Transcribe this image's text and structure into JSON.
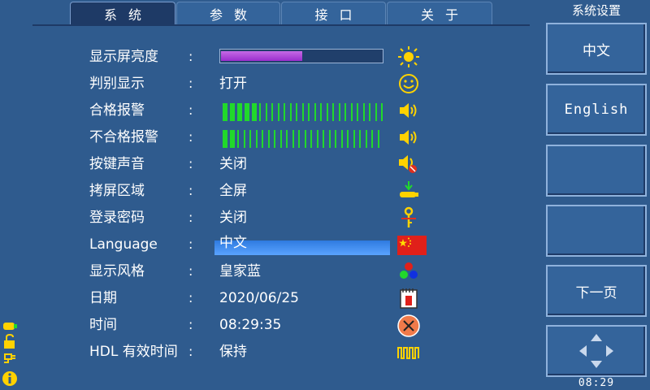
{
  "tabs": [
    {
      "label": "系统",
      "active": true
    },
    {
      "label": "参数",
      "active": false
    },
    {
      "label": "接口",
      "active": false
    },
    {
      "label": "关于",
      "active": false
    }
  ],
  "settings": {
    "brightness": {
      "label": "显示屏亮度",
      "level": 0.5
    },
    "judge_display": {
      "label": "判别显示",
      "value": "打开"
    },
    "pass_alarm": {
      "label": "合格报警",
      "level_ticks": 5,
      "total_ticks": 26
    },
    "fail_alarm": {
      "label": "不合格报警",
      "level_ticks": 2,
      "total_ticks": 26
    },
    "key_sound": {
      "label": "按键声音",
      "value": "关闭"
    },
    "capture_area": {
      "label": "拷屏区域",
      "value": "全屏"
    },
    "login_password": {
      "label": "登录密码",
      "value": "关闭"
    },
    "language": {
      "label": "Language",
      "value": "中文"
    },
    "display_style": {
      "label": "显示风格",
      "value": "皇家蓝"
    },
    "date": {
      "label": "日期",
      "value": "2020/06/25"
    },
    "time": {
      "label": "时间",
      "value": "08:29:35"
    },
    "hdl_time": {
      "label": "HDL 有效时间",
      "value": "保持"
    }
  },
  "colon": ":",
  "right_panel": {
    "title": "系统设置",
    "buttons": [
      "中文",
      "English",
      "",
      "",
      "下一页"
    ],
    "clock": "08:29"
  },
  "colors": {
    "background": "#2f5b8e",
    "accent_green": "#21d92b",
    "icon_yellow": "#ffd200",
    "highlight": "#3a8cf0"
  },
  "icons": [
    "sun-icon",
    "smiley-icon",
    "speaker-icon",
    "speaker-muted-icon",
    "usb-icon",
    "key-icon",
    "china-flag-icon",
    "rgb-dots-icon",
    "calendar-icon",
    "clock-icon",
    "pulse-icon",
    "nav-arrows-icon",
    "info-icon"
  ]
}
